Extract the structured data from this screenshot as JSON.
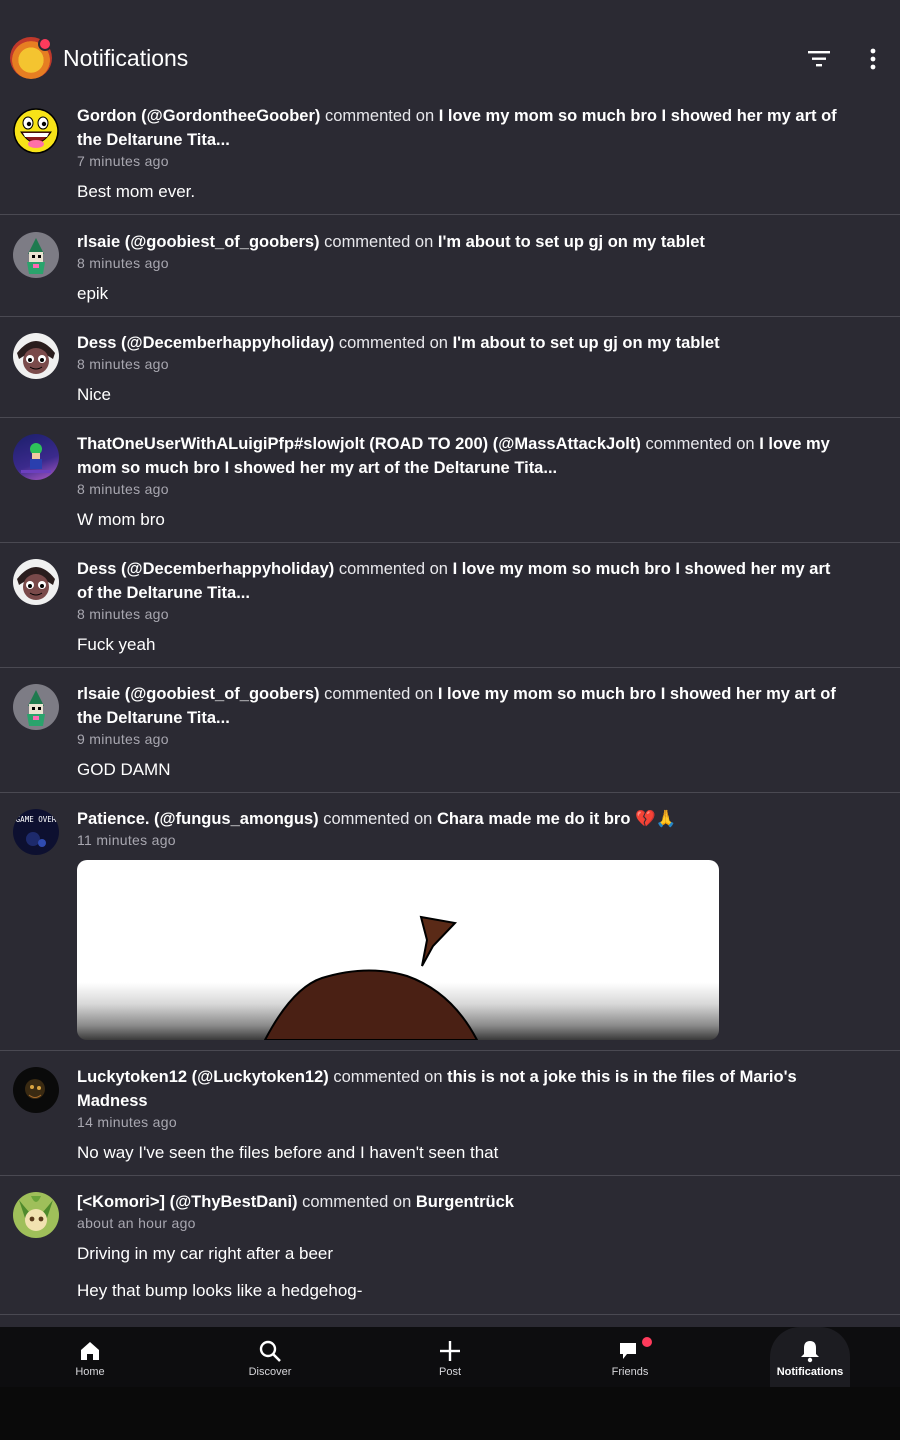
{
  "header": {
    "title": "Notifications"
  },
  "notifications": [
    {
      "user": "Gordon (@GordontheeGoober)",
      "action": "commented on",
      "post": "I love my mom so much bro I showed her my art of the Deltarune Tita...",
      "time": "7 minutes ago",
      "comment": "Best mom ever."
    },
    {
      "user": "rlsaie (@goobiest_of_goobers)",
      "action": "commented on",
      "post": "I'm about to set up gj on my tablet",
      "time": "8 minutes ago",
      "comment": "epik"
    },
    {
      "user": "Dess (@Decemberhappyholiday)",
      "action": "commented on",
      "post": "I'm about to set up gj on my tablet",
      "time": "8 minutes ago",
      "comment": "Nice"
    },
    {
      "user": "ThatOneUserWithALuigiPfp#slowjolt (ROAD TO 200) (@MassAttackJolt)",
      "action": "commented on",
      "post": "I love my mom so much bro I showed her my art of the Deltarune Tita...",
      "time": "8 minutes ago",
      "comment": "W mom bro"
    },
    {
      "user": "Dess (@Decemberhappyholiday)",
      "action": "commented on",
      "post": "I love my mom so much bro I showed her my art of the Deltarune Tita...",
      "time": "8 minutes ago",
      "comment": "Fuck yeah"
    },
    {
      "user": "rlsaie (@goobiest_of_goobers)",
      "action": "commented on",
      "post": "I love my mom so much bro I showed her my art of the Deltarune Tita...",
      "time": "9 minutes ago",
      "comment": "GOD DAMN"
    },
    {
      "user": "Patience. (@fungus_amongus)",
      "action": "commented on",
      "post": "Chara made me do it bro 💔🙏",
      "time": "11 minutes ago",
      "comment": ""
    },
    {
      "user": "Luckytoken12 (@Luckytoken12)",
      "action": "commented on",
      "post": "this is not a joke this is in the files of Mario's Madness",
      "time": "14 minutes ago",
      "comment": "No way I've seen the files before and I haven't seen that"
    },
    {
      "user": "[<Komori>] (@ThyBestDani)",
      "action": "commented on",
      "post": "Burgentrück",
      "time": "about an hour ago",
      "comment": "Driving in my car right after a beer",
      "comment2": "Hey that bump looks like a hedgehog-"
    }
  ],
  "avatar_labels": {
    "patience": "GAME OVER"
  },
  "tabs": [
    {
      "label": "Home",
      "icon": "home-icon"
    },
    {
      "label": "Discover",
      "icon": "search-icon"
    },
    {
      "label": "Post",
      "icon": "plus-icon"
    },
    {
      "label": "Friends",
      "icon": "chat-icon",
      "badge": true
    },
    {
      "label": "Notifications",
      "icon": "bell-icon",
      "active": true
    }
  ],
  "colors": {
    "background": "#2b2a33",
    "tabbar": "#0d0d0f",
    "badge": "#ff3b5c",
    "divider": "#4a4952"
  }
}
